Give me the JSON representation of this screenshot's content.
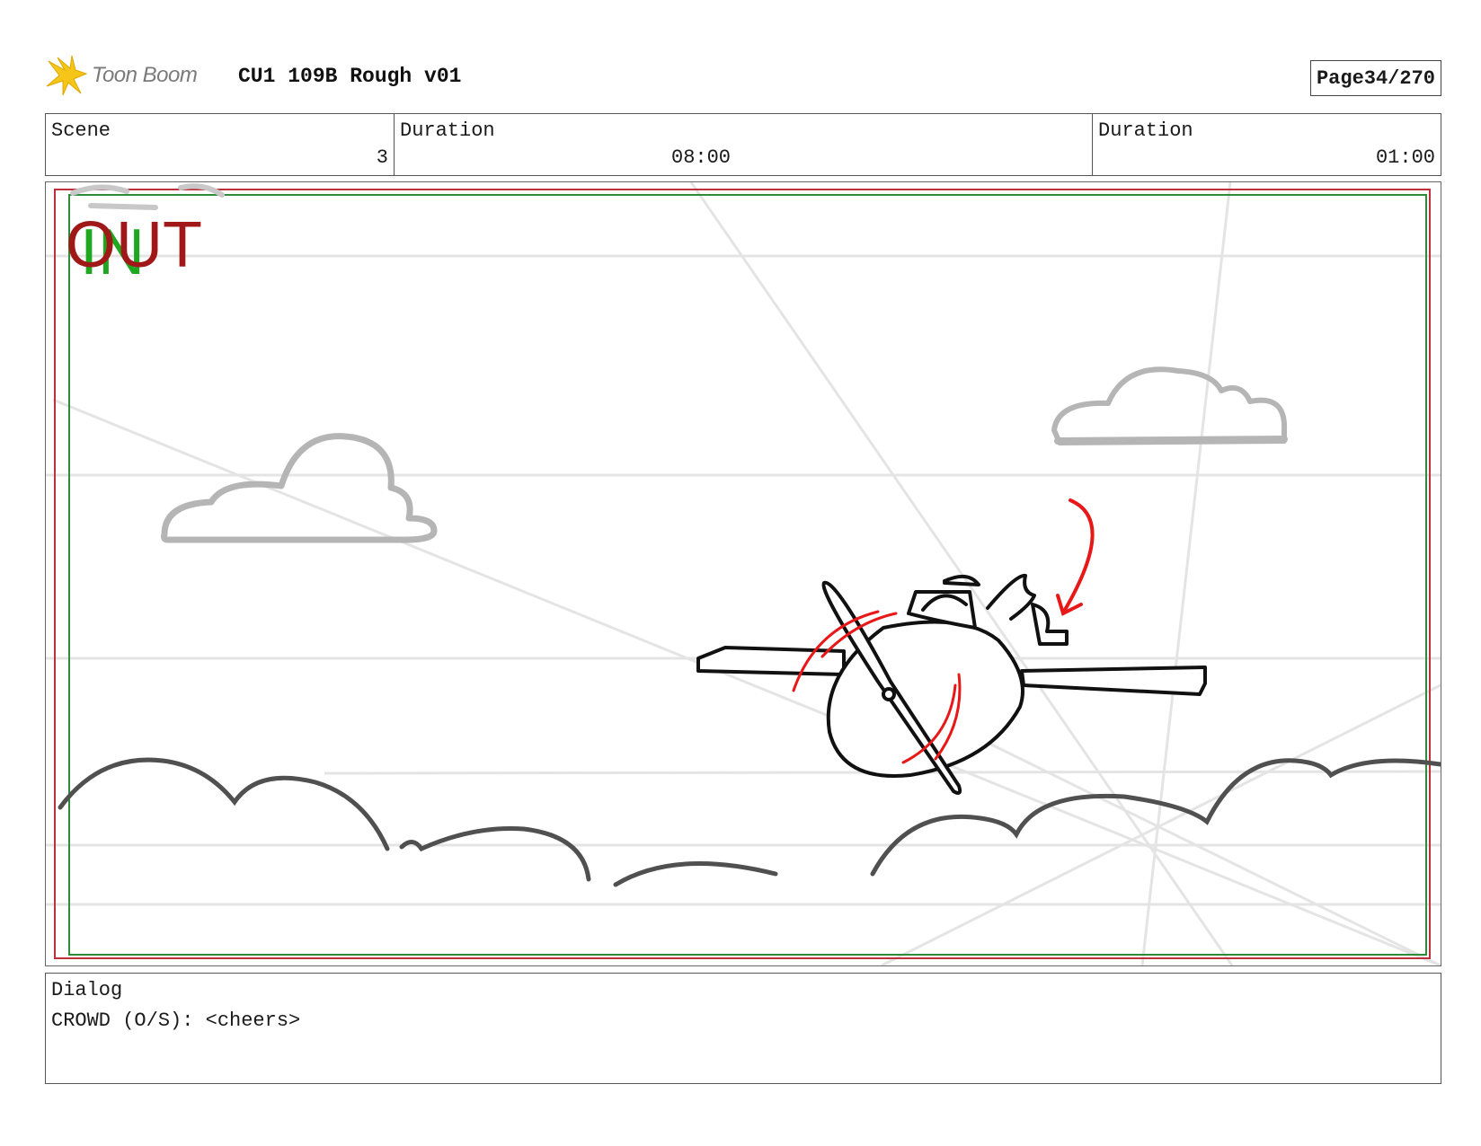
{
  "header": {
    "logo_text": "Toon Boom",
    "title": "CU1 109B Rough v01",
    "page_label": "Page",
    "page_value": "34/270"
  },
  "info": {
    "scene_label": "Scene",
    "scene_value": "3",
    "duration1_label": "Duration",
    "duration1_value": "08:00",
    "duration2_label": "Duration",
    "duration2_value": "01:00"
  },
  "panel": {
    "in_marker": "IN",
    "out_marker": "OUT",
    "icons": [
      "safe-frame",
      "cloud",
      "plane",
      "propeller",
      "motion-arrow"
    ]
  },
  "dialog": {
    "label": "Dialog",
    "lines": [
      "CROWD (O/S): <cheers>"
    ]
  },
  "colors": {
    "frame_red": "#c0303a",
    "frame_green": "#2e8b3a",
    "in_green": "#1fa81f",
    "out_red": "#a01818",
    "action_red": "#e81818",
    "sketch_black": "#111111",
    "cloud_gray": "#b5b5b5",
    "perspective_gray": "#e4e4e4",
    "logo_yellow": "#f5c518"
  }
}
